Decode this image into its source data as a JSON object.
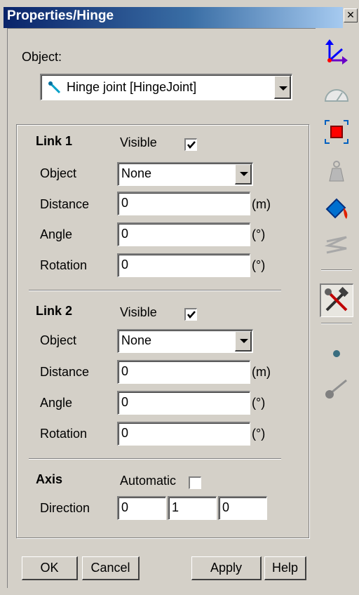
{
  "window": {
    "title": "Properties/Hinge",
    "close_glyph": "✕"
  },
  "object": {
    "label": "Object:",
    "selected": "Hinge joint  [HingeJoint]",
    "icon": "hinge-joint-icon"
  },
  "link1": {
    "heading": "Link 1",
    "visible_label": "Visible",
    "visible_checked": true,
    "object_label": "Object",
    "object_value": "None",
    "distance_label": "Distance",
    "distance_value": "0",
    "distance_unit": "(m)",
    "angle_label": "Angle",
    "angle_value": "0",
    "angle_unit": "(°)",
    "rotation_label": "Rotation",
    "rotation_value": "0",
    "rotation_unit": "(°)"
  },
  "link2": {
    "heading": "Link 2",
    "visible_label": "Visible",
    "visible_checked": true,
    "object_label": "Object",
    "object_value": "None",
    "distance_label": "Distance",
    "distance_value": "0",
    "distance_unit": "(m)",
    "angle_label": "Angle",
    "angle_value": "0",
    "angle_unit": "(°)",
    "rotation_label": "Rotation",
    "rotation_value": "0",
    "rotation_unit": "(°)"
  },
  "axis": {
    "heading": "Axis",
    "automatic_label": "Automatic",
    "automatic_checked": false,
    "direction_label": "Direction",
    "direction_x": "0",
    "direction_y": "1",
    "direction_z": "0"
  },
  "buttons": {
    "ok": "OK",
    "cancel": "Cancel",
    "apply": "Apply",
    "help": "Help"
  },
  "toolbar": {
    "icons": [
      "coordinates-icon",
      "gauge-icon",
      "bounding-box-icon",
      "mass-weight-icon",
      "paint-bucket-icon",
      "spring-icon",
      "tools-icon",
      "point-icon",
      "hinge-link-icon"
    ],
    "pressed": "tools-icon"
  },
  "colors": {
    "title_start": "#0a246a",
    "title_end": "#a6caf0",
    "face": "#d4d0c8"
  }
}
